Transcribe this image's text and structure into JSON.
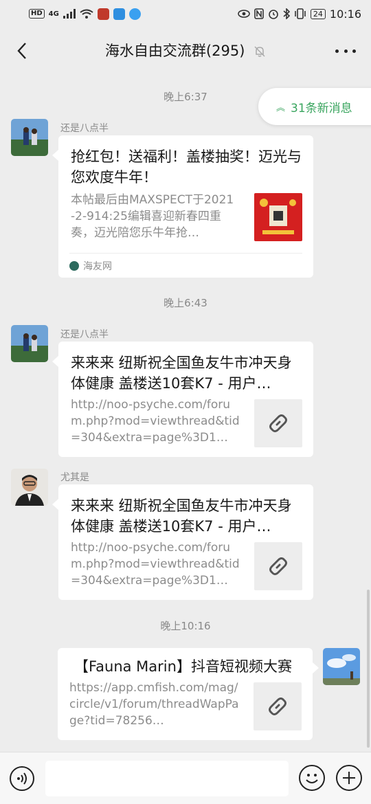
{
  "status_bar": {
    "hd": "HD",
    "network": "4G",
    "battery": "24",
    "time": "10:16",
    "icons": [
      "hd-icon",
      "signal-icon",
      "wifi-icon",
      "app-notification-icon",
      "eye-icon",
      "nfc-icon",
      "alarm-icon",
      "bluetooth-icon",
      "vibrate-icon",
      "battery-icon"
    ]
  },
  "header": {
    "title": "海水自由交流群(295)",
    "muted_icon": "bell-off-icon",
    "back_icon": "chevron-left-icon",
    "more_icon": "more-dots-icon"
  },
  "new_messages": {
    "label": "31条新消息",
    "icon": "double-chevron-up-icon"
  },
  "messages": [
    {
      "time": "晚上6:37",
      "sender": "还是八点半",
      "title": "抢红包！送福利！盖楼抽奖！迈光与您欢度牛年！",
      "description": "本帖最后由MAXSPECT于2021-2-914:25编辑喜迎新春四重奏，迈光陪您乐牛年抢…",
      "source": "海友网"
    },
    {
      "time": "晚上6:43",
      "sender": "还是八点半",
      "title": "来来来 纽斯祝全国鱼友牛市冲天身体健康 盖楼送10套K7 - 用户…",
      "description": "http://noo-psyche.com/forum.php?mod=viewthread&tid=304&extra=page%3D1…"
    },
    {
      "sender": "尤其是",
      "title": "来来来 纽斯祝全国鱼友牛市冲天身体健康 盖楼送10套K7 - 用户…",
      "description": "http://noo-psyche.com/forum.php?mod=viewthread&tid=304&extra=page%3D1…"
    },
    {
      "time": "晚上10:16",
      "title": "【Fauna Marin】抖音短视频大赛",
      "description": "https://app.cmfish.com/mag/circle/v1/forum/threadWapPage?tid=78256…"
    }
  ],
  "input_bar": {
    "placeholder": "",
    "voice_icon": "voice-icon",
    "emoji_icon": "emoji-icon",
    "plus_icon": "plus-icon"
  },
  "colors": {
    "accent_green": "#3aa55f",
    "background": "#ededed",
    "card": "#ffffff"
  }
}
